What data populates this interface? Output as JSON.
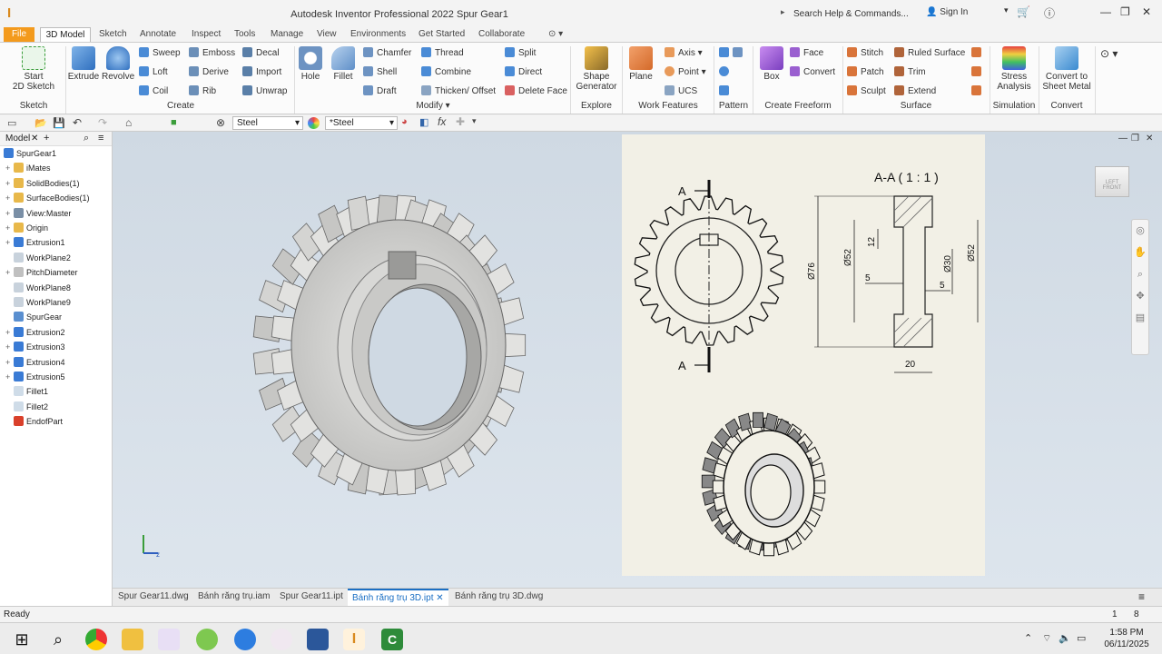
{
  "window": {
    "title": "Autodesk Inventor Professional 2022   Spur Gear1",
    "search_placeholder": "Search Help & Commands...",
    "sign_in": "Sign In"
  },
  "menu_tabs": [
    "File",
    "3D Model",
    "Sketch",
    "Annotate",
    "Inspect",
    "Tools",
    "Manage",
    "View",
    "Environments",
    "Get Started",
    "Collaborate"
  ],
  "ribbon": {
    "sketch": {
      "start": "Start",
      "sketch2d": "2D Sketch",
      "group": "Sketch"
    },
    "create": {
      "extrude": "Extrude",
      "revolve": "Revolve",
      "sweep": "Sweep",
      "emboss": "Emboss",
      "decal": "Decal",
      "loft": "Loft",
      "derive": "Derive",
      "import": "Import",
      "coil": "Coil",
      "rib": "Rib",
      "unwrap": "Unwrap",
      "group": "Create"
    },
    "modify": {
      "hole": "Hole",
      "fillet": "Fillet",
      "chamfer": "Chamfer",
      "thread": "Thread",
      "split": "Split",
      "shell": "Shell",
      "combine": "Combine",
      "direct": "Direct",
      "draft": "Draft",
      "thicken": "Thicken/ Offset",
      "delete_face": "Delete Face",
      "group": "Modify"
    },
    "explore": {
      "shape": "Shape",
      "generator": "Generator",
      "group": "Explore"
    },
    "work": {
      "plane": "Plane",
      "axis": "Axis",
      "point": "Point",
      "ucs": "UCS",
      "group": "Work Features"
    },
    "pattern": {
      "group": "Pattern"
    },
    "freeform": {
      "box": "Box",
      "face": "Face",
      "convert": "Convert",
      "group": "Create Freeform"
    },
    "surface": {
      "stitch": "Stitch",
      "ruled": "Ruled Surface",
      "patch": "Patch",
      "trim": "Trim",
      "sculpt": "Sculpt",
      "extend": "Extend",
      "group": "Surface"
    },
    "simulation": {
      "stress": "Stress",
      "analysis": "Analysis",
      "group": "Simulation"
    },
    "convert": {
      "to": "Convert to",
      "sheet": "Sheet Metal",
      "group": "Convert"
    }
  },
  "qat": {
    "material": "Steel",
    "appearance": "*Steel"
  },
  "browser": {
    "title": "Model",
    "items": [
      {
        "label": "SpurGear1",
        "indent": 0,
        "color": "#3a7bd5",
        "plus": false
      },
      {
        "label": "iMates",
        "indent": 1,
        "color": "#e8b84a",
        "plus": true
      },
      {
        "label": "SolidBodies(1)",
        "indent": 1,
        "color": "#e8b84a",
        "plus": true
      },
      {
        "label": "SurfaceBodies(1)",
        "indent": 1,
        "color": "#e8b84a",
        "plus": true
      },
      {
        "label": "View:Master",
        "indent": 1,
        "color": "#7a8fa6",
        "plus": true
      },
      {
        "label": "Origin",
        "indent": 1,
        "color": "#e8b84a",
        "plus": true
      },
      {
        "label": "Extrusion1",
        "indent": 1,
        "color": "#3a7bd5",
        "plus": true
      },
      {
        "label": "WorkPlane2",
        "indent": 1,
        "color": "#c8d2dc",
        "plus": false
      },
      {
        "label": "PitchDiameter",
        "indent": 1,
        "color": "#c0c0c0",
        "plus": true
      },
      {
        "label": "WorkPlane8",
        "indent": 1,
        "color": "#c8d2dc",
        "plus": false
      },
      {
        "label": "WorkPlane9",
        "indent": 1,
        "color": "#c8d2dc",
        "plus": false
      },
      {
        "label": "SpurGear",
        "indent": 1,
        "color": "#5a8fd0",
        "plus": false
      },
      {
        "label": "Extrusion2",
        "indent": 1,
        "color": "#3a7bd5",
        "plus": true
      },
      {
        "label": "Extrusion3",
        "indent": 1,
        "color": "#3a7bd5",
        "plus": true
      },
      {
        "label": "Extrusion4",
        "indent": 1,
        "color": "#3a7bd5",
        "plus": true
      },
      {
        "label": "Extrusion5",
        "indent": 1,
        "color": "#3a7bd5",
        "plus": true
      },
      {
        "label": "Fillet1",
        "indent": 1,
        "color": "#cfdce8",
        "plus": false
      },
      {
        "label": "Fillet2",
        "indent": 1,
        "color": "#cfdce8",
        "plus": false
      },
      {
        "label": "EndofPart",
        "indent": 1,
        "color": "#d9402b",
        "plus": false
      }
    ]
  },
  "drawing": {
    "section_title": "A-A ( 1 : 1 )",
    "label_a": "A",
    "dims": {
      "d76": "Ø76",
      "d52a": "Ø52",
      "d30": "Ø30",
      "d52b": "Ø52",
      "w12": "12",
      "w5a": "5",
      "w5b": "5",
      "w20": "20"
    }
  },
  "viewcube": {
    "left": "LEFT",
    "front": "FRONT"
  },
  "doc_tabs": [
    "Spur Gear11.dwg",
    "Bánh răng trụ.iam",
    "Spur Gear11.ipt",
    "Bánh răng trụ 3D.ipt",
    "Bánh răng trụ 3D.dwg"
  ],
  "status": {
    "text": "Ready",
    "n1": "1",
    "n2": "8"
  },
  "taskbar": {
    "time": "1:58 PM",
    "date": "06/11/2025"
  }
}
